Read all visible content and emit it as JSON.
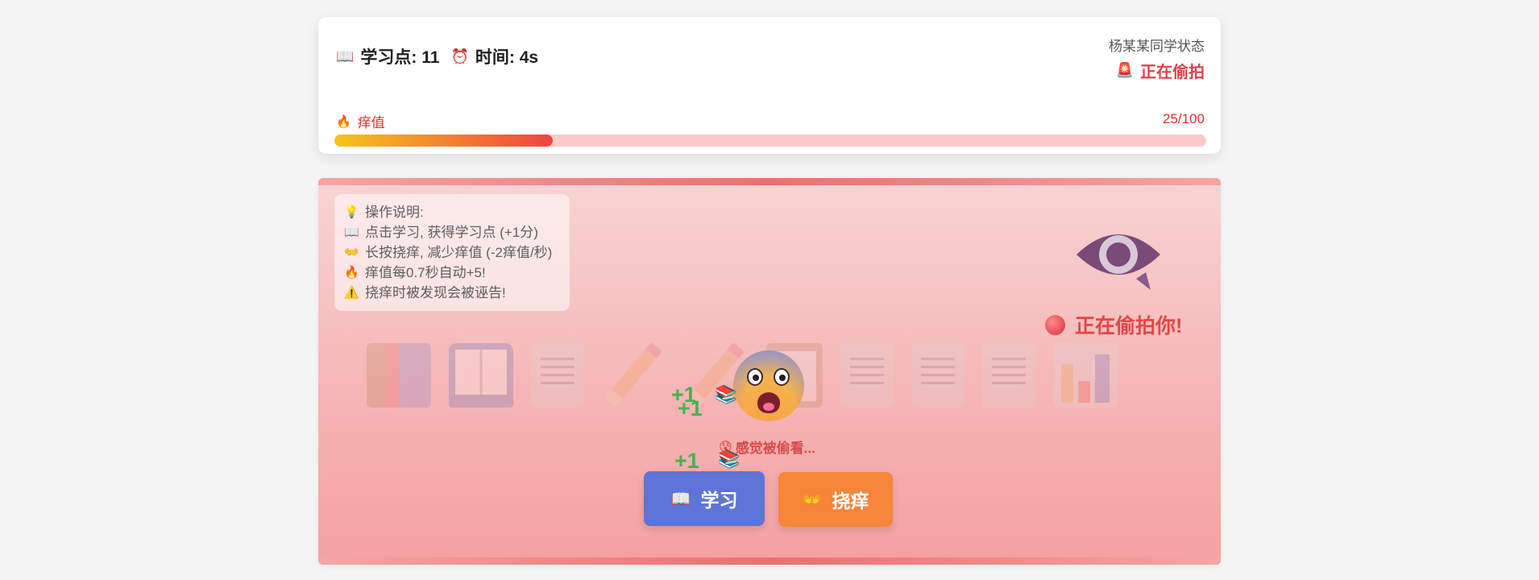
{
  "stats": {
    "study_icon": "open-book-icon",
    "study_label": "学习点: 11",
    "timer_icon": "alarm-clock-icon",
    "time_label": "时间: 4s"
  },
  "status": {
    "title": "杨某某同学状态",
    "icon": "siren-icon",
    "value": "正在偷拍"
  },
  "itch": {
    "icon": "fire-icon",
    "label": "痒值",
    "value_text": "25/100",
    "fill_percent": 25,
    "colors": {
      "start": "#f5c518",
      "end": "#ef4444",
      "track": "#fdcaca"
    }
  },
  "help": {
    "lines": [
      {
        "icon": "💡",
        "text": "操作说明:"
      },
      {
        "icon": "📖",
        "text": "点击学习, 获得学习点 (+1分)"
      },
      {
        "icon": "👐",
        "text": "长按挠痒, 减少痒值 (-2痒值/秒)"
      },
      {
        "icon": "🔥",
        "text": "痒值每0.7秒自动+5!"
      },
      {
        "icon": "⚠️",
        "text": "挠痒时被发现会被诬告!"
      }
    ]
  },
  "watcher": {
    "eye_icon": "eye-speech-bubble-icon",
    "label": "正在偷拍你!"
  },
  "player": {
    "face_icon": "anxious-face-icon",
    "floats": [
      "+1",
      "+1",
      "+1"
    ],
    "feeling_text": "感觉被偷看..."
  },
  "buttons": {
    "study_label": "学习",
    "study_icon": "📖",
    "scratch_label": "挠痒",
    "scratch_icon": "👐"
  },
  "theme": {
    "accent_red": "#e04848",
    "study_button": "#5e74d8",
    "scratch_button": "#f7853a",
    "plus_green": "#4caf50"
  }
}
